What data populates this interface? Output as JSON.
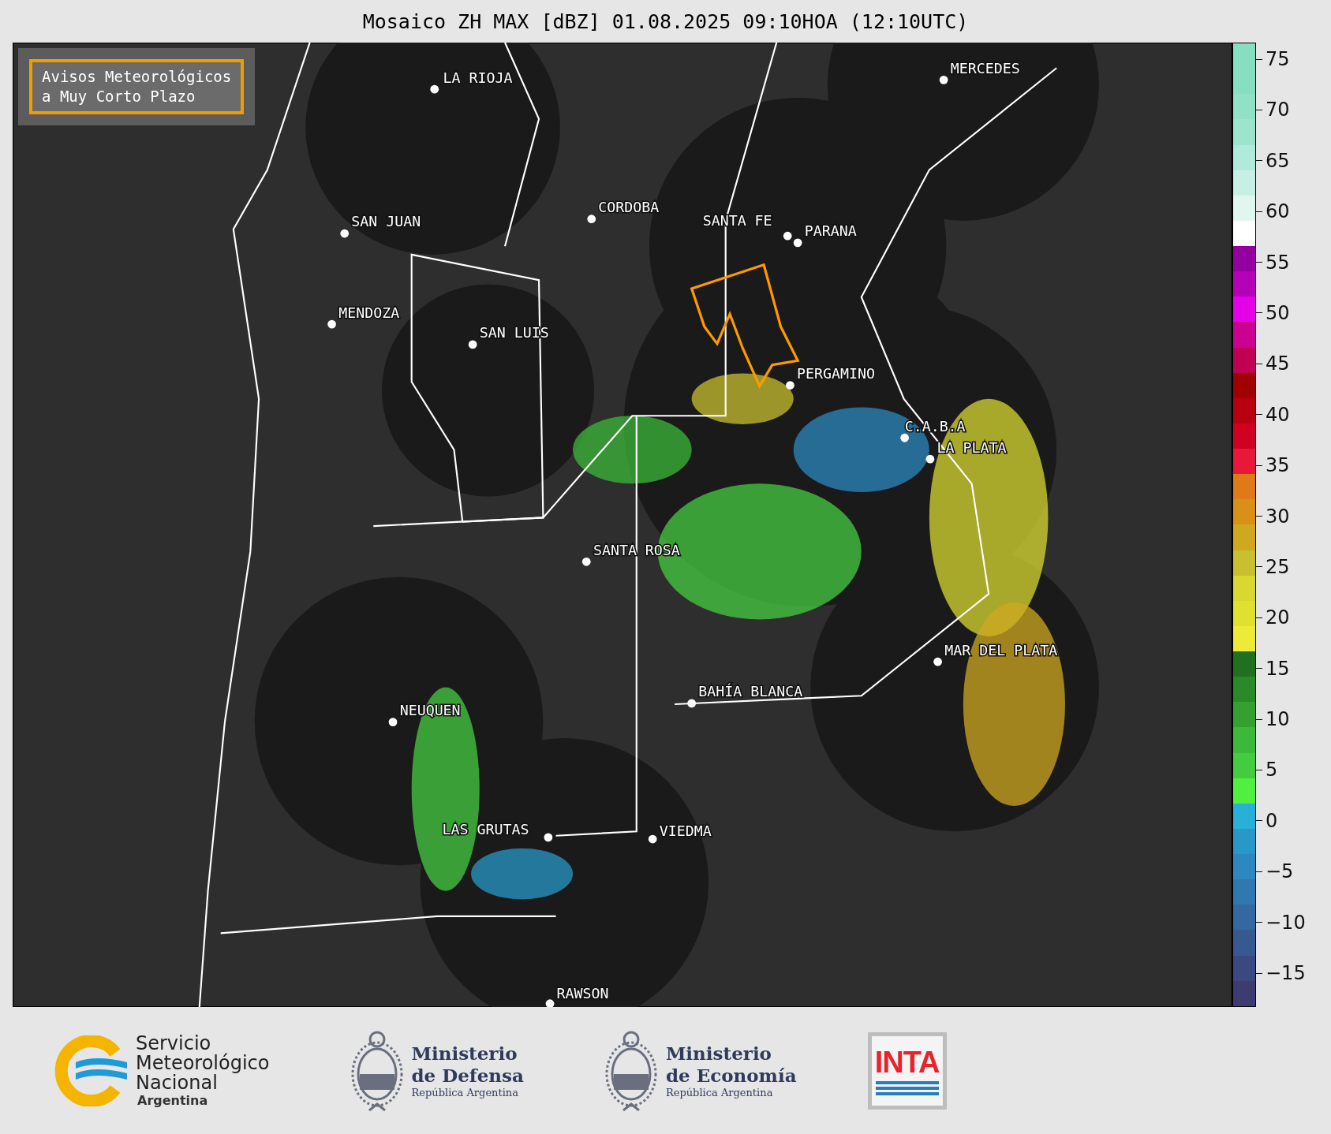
{
  "title": "Mosaico ZH MAX [dBZ] 01.08.2025 09:10HOA (12:10UTC)",
  "legend_box": {
    "lines": [
      "Avisos Meteorológicos",
      "a Muy Corto Plazo"
    ]
  },
  "cities": [
    {
      "name": "LA RIOJA"
    },
    {
      "name": "MERCEDES"
    },
    {
      "name": "SAN JUAN"
    },
    {
      "name": "CORDOBA"
    },
    {
      "name": "SANTA FE"
    },
    {
      "name": "PARANA"
    },
    {
      "name": "MENDOZA"
    },
    {
      "name": "SAN LUIS"
    },
    {
      "name": "PERGAMINO"
    },
    {
      "name": "C.A.B.A"
    },
    {
      "name": "LA PLATA"
    },
    {
      "name": "SANTA ROSA"
    },
    {
      "name": "MAR DEL PLATA"
    },
    {
      "name": "BAHÍA BLANCA"
    },
    {
      "name": "NEUQUEN"
    },
    {
      "name": "LAS GRUTAS"
    },
    {
      "name": "VIEDMA"
    },
    {
      "name": "RAWSON"
    }
  ],
  "colorbar": {
    "ticks": [
      "75",
      "70",
      "65",
      "60",
      "55",
      "50",
      "45",
      "40",
      "35",
      "30",
      "25",
      "20",
      "15",
      "10",
      "5",
      "0",
      "−5",
      "−10",
      "−15"
    ],
    "bands": [
      {
        "color": "#86dfc0"
      },
      {
        "color": "#86dfc0"
      },
      {
        "color": "#90e1c5"
      },
      {
        "color": "#9ce5cc"
      },
      {
        "color": "#b0eada"
      },
      {
        "color": "#c6f0e3"
      },
      {
        "color": "#e0f7f0"
      },
      {
        "color": "#ffffff"
      },
      {
        "color": "#9400a0"
      },
      {
        "color": "#b400b8"
      },
      {
        "color": "#e600e8"
      },
      {
        "color": "#cc0090"
      },
      {
        "color": "#c00050"
      },
      {
        "color": "#a00000"
      },
      {
        "color": "#b80010"
      },
      {
        "color": "#d00020"
      },
      {
        "color": "#e81838"
      },
      {
        "color": "#e07a18"
      },
      {
        "color": "#d89018"
      },
      {
        "color": "#d0a820"
      },
      {
        "color": "#c8c030"
      },
      {
        "color": "#d8d830"
      },
      {
        "color": "#e0e030"
      },
      {
        "color": "#eeea38"
      },
      {
        "color": "#207020"
      },
      {
        "color": "#2a8a28"
      },
      {
        "color": "#33a030"
      },
      {
        "color": "#3cb83a"
      },
      {
        "color": "#44cc40"
      },
      {
        "color": "#50f040"
      },
      {
        "color": "#28b0d8"
      },
      {
        "color": "#2898c8"
      },
      {
        "color": "#2c88be"
      },
      {
        "color": "#3078b0"
      },
      {
        "color": "#3468a0"
      },
      {
        "color": "#385890"
      },
      {
        "color": "#3a4a80"
      },
      {
        "color": "#3c3c70"
      }
    ]
  },
  "footer": {
    "smn": {
      "lines": [
        "Servicio",
        "Meteorológico",
        "Nacional"
      ],
      "country": "Argentina"
    },
    "ministries": [
      {
        "line1": "Ministerio",
        "line2": "de Defensa",
        "subtitle": "República Argentina"
      },
      {
        "line1": "Ministerio",
        "line2": "de Economía",
        "subtitle": "República Argentina"
      }
    ],
    "badge": "INTA"
  }
}
